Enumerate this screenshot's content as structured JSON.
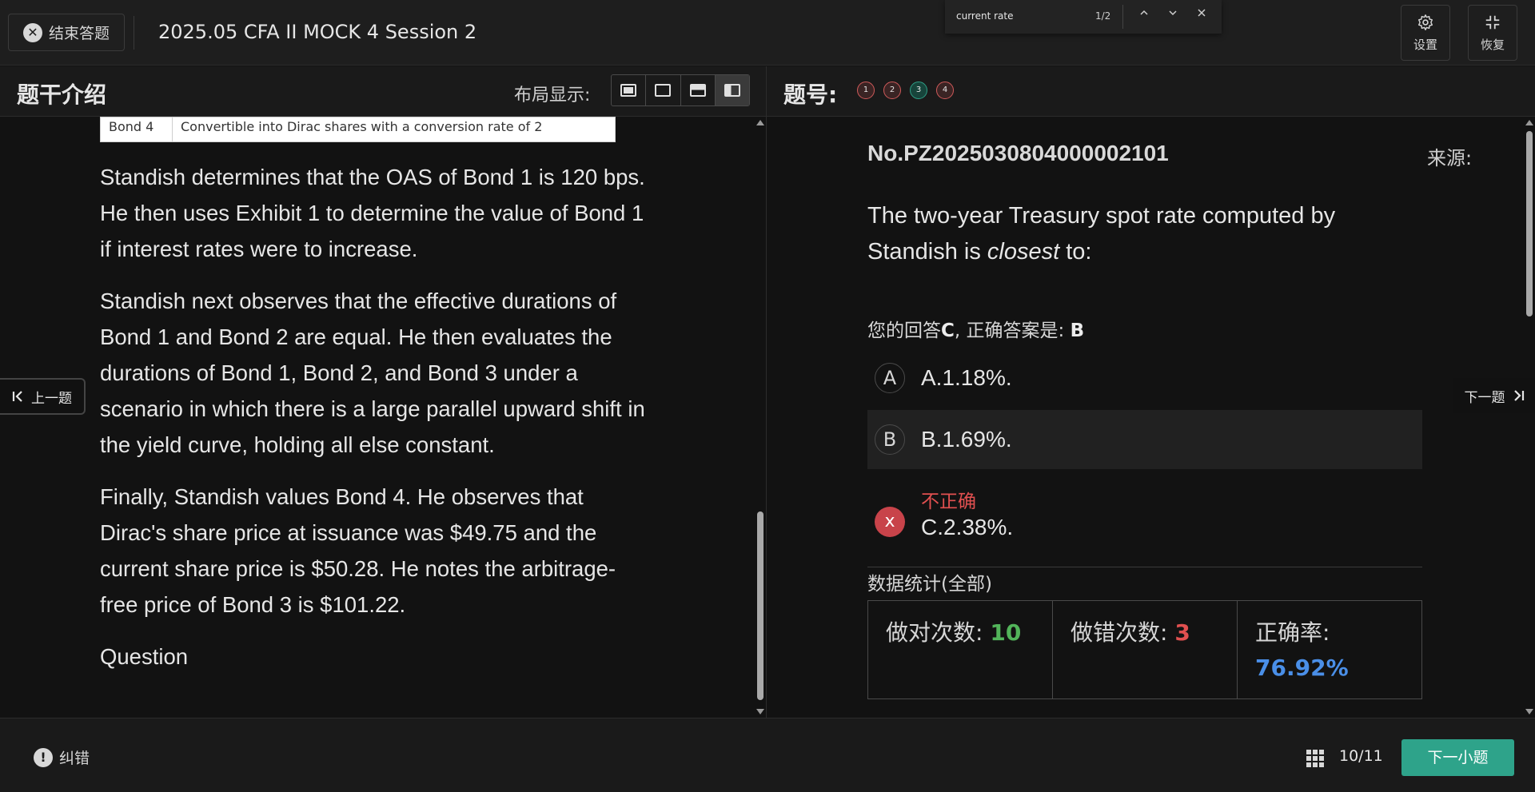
{
  "topbar": {
    "end_label": "结束答题",
    "exam_title": "2025.05 CFA II MOCK 4 Session 2",
    "settings_label": "设置",
    "restore_label": "恢复"
  },
  "find": {
    "query": "current rate",
    "count": "1/2"
  },
  "left": {
    "title": "题干介绍",
    "layout_label": "布局显示:",
    "table_row": [
      "Bond 4",
      "Convertible into Dirac shares with a conversion rate of 2"
    ],
    "paragraphs": [
      "Standish determines that the OAS of Bond 1 is 120 bps. He then uses Exhibit 1 to determine the value of Bond 1 if interest rates were to increase.",
      "Standish next observes that the effective durations of Bond 1 and Bond 2 are equal. He then evaluates the durations of Bond 1, Bond 2, and Bond 3 under a scenario in which there is a large parallel upward shift in the yield curve, holding all else constant.",
      "Finally, Standish values Bond 4. He observes that Dirac's share price at issuance was $49.75 and the current share price is $50.28. He notes the arbitrage-free price of Bond 3 is $101.22.",
      "Question"
    ],
    "prev_label": "上一题"
  },
  "right": {
    "qnum_label": "题号:",
    "question_dots": [
      {
        "label": "1",
        "status": "wrong"
      },
      {
        "label": "2",
        "status": "wrong"
      },
      {
        "label": "3",
        "status": "right"
      },
      {
        "label": "4",
        "status": "wrong"
      }
    ],
    "question_id": "No.PZ2025030804000002101",
    "source_label": "来源:",
    "question_pre": "The two-year Treasury spot rate computed by Standish is ",
    "question_em": "closest",
    "question_post": " to:",
    "answer_prefix": "您的回答",
    "your_answer": "C",
    "answer_mid": ", 正确答案是: ",
    "correct_answer": "B",
    "options": [
      {
        "letter": "A",
        "text": "A.1.18%."
      },
      {
        "letter": "B",
        "text": "B.1.69%."
      }
    ],
    "wrong_option": {
      "mark": "x",
      "label": "不正确",
      "text": "C.2.38%."
    },
    "stats": {
      "title": "数据统计(全部)",
      "correct_label": "做对次数: ",
      "correct_value": "10",
      "wrong_label": "做错次数: ",
      "wrong_value": "3",
      "rate_label": "正确率:",
      "rate_value": "76.92%"
    },
    "next_label": "下一题"
  },
  "bottom": {
    "report_label": "纠错",
    "page": "10/11",
    "next_sub_label": "下一小题"
  },
  "colors": {
    "accent": "#2ea38a",
    "correct": "#52b45a",
    "wrong": "#e15050",
    "rate": "#4a8fe8"
  }
}
